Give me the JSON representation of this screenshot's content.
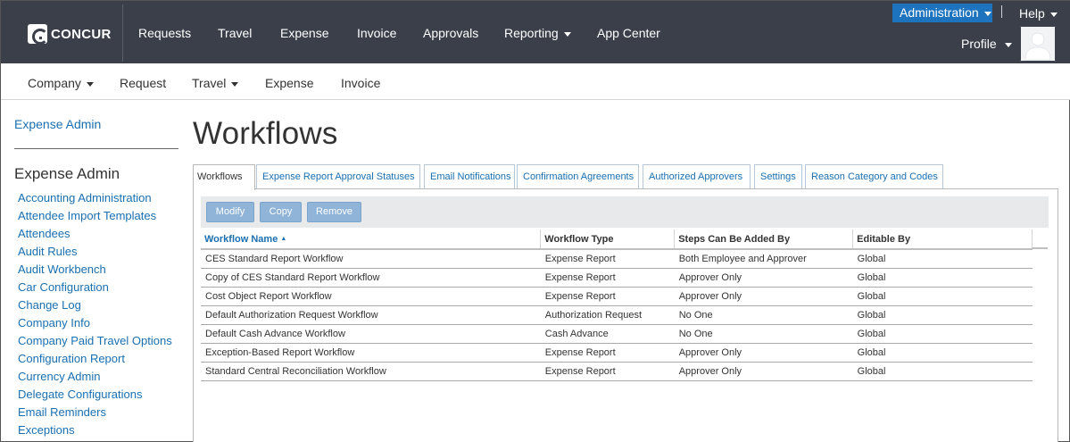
{
  "brand": {
    "logo_text": "CONCUR"
  },
  "topnav": {
    "items": [
      "Requests",
      "Travel",
      "Expense",
      "Invoice",
      "Approvals",
      "Reporting",
      "App Center"
    ],
    "admin_label": "Administration",
    "help_label": "Help",
    "profile_label": "Profile"
  },
  "subnav": {
    "items": [
      "Company",
      "Request",
      "Travel",
      "Expense",
      "Invoice"
    ]
  },
  "sidebar": {
    "top_link": "Expense Admin",
    "heading": "Expense Admin",
    "links": [
      "Accounting Administration",
      "Attendee Import Templates",
      "Attendees",
      "Audit Rules",
      "Audit Workbench",
      "Car Configuration",
      "Change Log",
      "Company Info",
      "Company Paid Travel Options",
      "Configuration Report",
      "Currency Admin",
      "Delegate Configurations",
      "Email Reminders",
      "Exceptions"
    ]
  },
  "page": {
    "title": "Workflows",
    "tabs": [
      "Workflows",
      "Expense Report Approval Statuses",
      "Email Notifications",
      "Confirmation Agreements",
      "Authorized Approvers",
      "Settings",
      "Reason Category and Codes"
    ],
    "toolbar": {
      "modify": "Modify",
      "copy": "Copy",
      "remove": "Remove"
    },
    "columns": [
      "Workflow Name",
      "Workflow Type",
      "Steps Can Be Added By",
      "Editable By"
    ],
    "rows": [
      [
        "CES Standard Report Workflow",
        "Expense Report",
        "Both Employee and Approver",
        "Global"
      ],
      [
        "Copy of CES Standard Report Workflow",
        "Expense Report",
        "Approver Only",
        "Global"
      ],
      [
        "Cost Object Report Workflow",
        "Expense Report",
        "Approver Only",
        "Global"
      ],
      [
        "Default Authorization Request Workflow",
        "Authorization Request",
        "No One",
        "Global"
      ],
      [
        "Default Cash Advance Workflow",
        "Cash Advance",
        "No One",
        "Global"
      ],
      [
        "Exception-Based Report Workflow",
        "Expense Report",
        "Approver Only",
        "Global"
      ],
      [
        "Standard Central Reconciliation Workflow",
        "Expense Report",
        "Approver Only",
        "Global"
      ]
    ]
  },
  "colors": {
    "topbar": "#3a3f4a",
    "accent": "#1e73be",
    "link": "#1a6fb0",
    "button_disabled": "#8fb4d8"
  },
  "icons": {
    "logo": "concur-logo-icon",
    "caret": "caret-down-icon",
    "avatar": "user-silhouette-icon",
    "sort": "sort-ascending-icon"
  }
}
